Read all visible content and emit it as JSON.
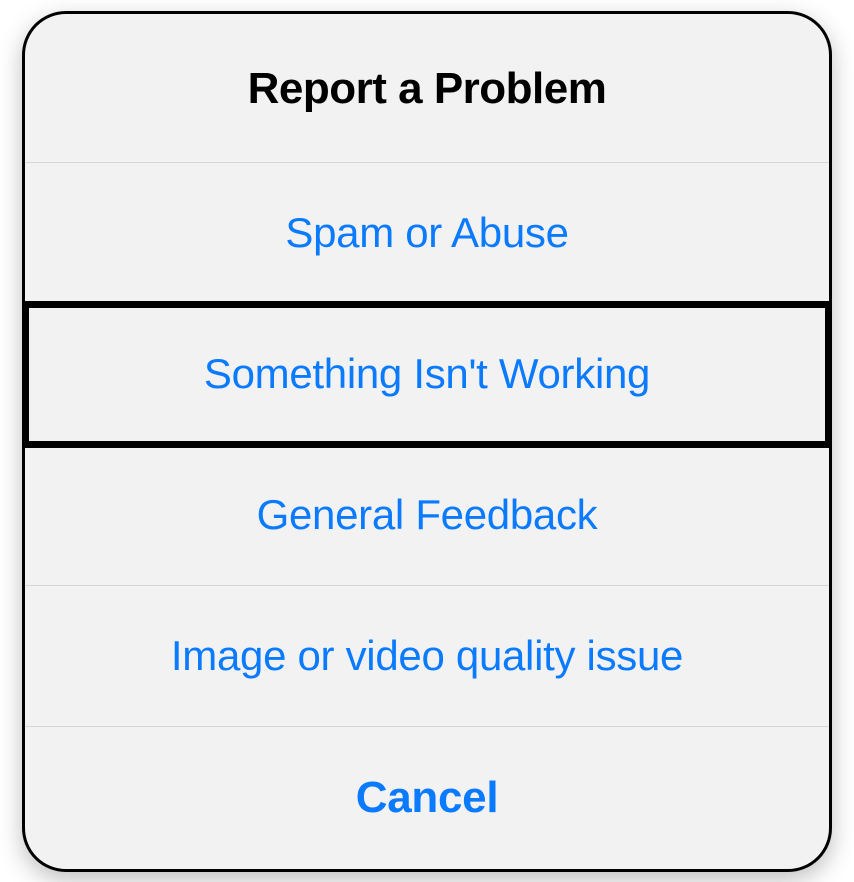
{
  "dialog": {
    "title": "Report a Problem",
    "options": [
      {
        "label": "Spam or Abuse",
        "highlighted": false
      },
      {
        "label": "Something Isn't Working",
        "highlighted": true
      },
      {
        "label": "General Feedback",
        "highlighted": false
      },
      {
        "label": "Image or video quality issue",
        "highlighted": false
      }
    ],
    "cancel_label": "Cancel"
  },
  "colors": {
    "accent": "#0a7aff",
    "background": "#f2f2f2",
    "divider": "#d6d6d6",
    "title": "#000000"
  }
}
